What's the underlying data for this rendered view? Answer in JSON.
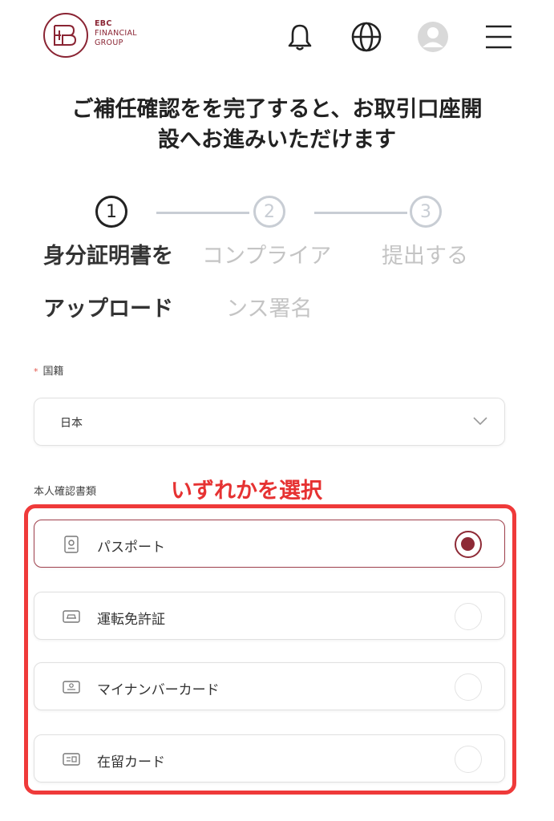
{
  "header": {
    "logo_line1": "EBC",
    "logo_line2": "FINANCIAL",
    "logo_line3": "GROUP",
    "icons": [
      "bell-icon",
      "globe-icon",
      "user-avatar-icon",
      "menu-icon"
    ]
  },
  "title": {
    "line1": "ご補任確認をを完了すると、お取引口座開",
    "line2": "設へお進みいただけます"
  },
  "stepper": {
    "steps": [
      {
        "number": "1",
        "label_line1": "身分証明書を",
        "label_line2": "アップロード",
        "state": "active"
      },
      {
        "number": "2",
        "label_line1": "コンプライア",
        "label_line2": "ンス署名",
        "state": "inactive"
      },
      {
        "number": "3",
        "label_line1": "提出する",
        "label_line2": "",
        "state": "inactive"
      }
    ]
  },
  "form": {
    "nationality": {
      "required_mark": "*",
      "label": "国籍",
      "value": "日本"
    },
    "id_type": {
      "label": "本人確認書類",
      "hint": "いずれかを選択",
      "options": [
        {
          "label": "パスポート",
          "icon": "passport-icon",
          "selected": true
        },
        {
          "label": "運転免許証",
          "icon": "car-icon",
          "selected": false
        },
        {
          "label": "マイナンバーカード",
          "icon": "id-card-icon",
          "selected": false
        },
        {
          "label": "在留カード",
          "icon": "residence-card-icon",
          "selected": false
        }
      ]
    }
  },
  "colors": {
    "brand": "#8e2a36",
    "highlight": "#ef3a3a",
    "inactive": "#c8cdd4"
  }
}
